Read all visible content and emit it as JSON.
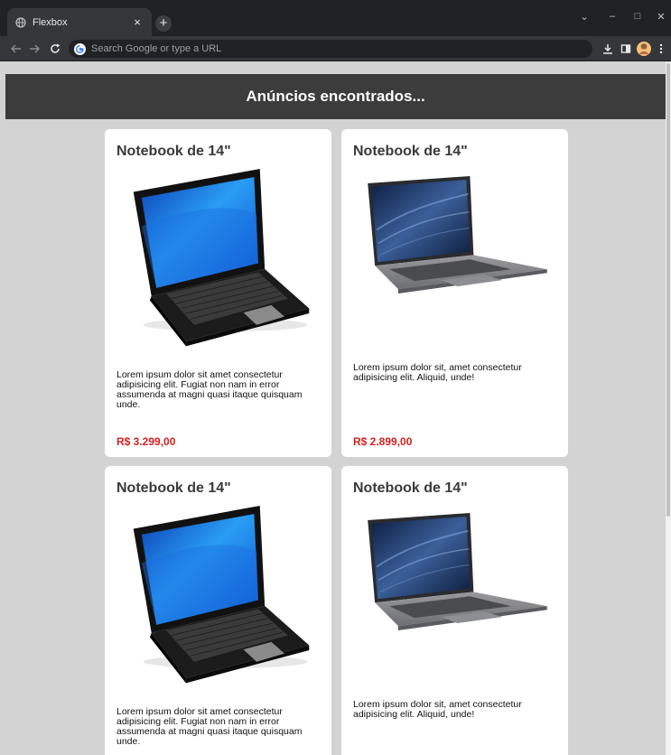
{
  "browser": {
    "tab_title": "Flexbox",
    "tab_close": "×",
    "new_tab": "+",
    "omnibox_placeholder": "Search Google or type a URL",
    "window_controls": {
      "dropdown": "⌄",
      "minimize": "–",
      "maximize": "□",
      "close": "✕"
    }
  },
  "page": {
    "header_title": "Anúncios encontrados...",
    "cards": [
      {
        "title": "Notebook de 14\"",
        "image": "black-laptop-illustration",
        "description": "Lorem ipsum dolor sit amet consectetur adipisicing elit. Fugiat non nam in error assumenda at magni quasi itaque quisquam unde.",
        "price": "R$ 3.299,00"
      },
      {
        "title": "Notebook de 14\"",
        "image": "silver-laptop-photo",
        "description": "Lorem ipsum dolor sit, amet consectetur adipisicing elit. Aliquid, unde!",
        "price": "R$ 2.899,00"
      },
      {
        "title": "Notebook de 14\"",
        "image": "black-laptop-illustration",
        "description": "Lorem ipsum dolor sit amet consectetur adipisicing elit. Fugiat non nam in error assumenda at magni quasi itaque quisquam unde."
      },
      {
        "title": "Notebook de 14\"",
        "image": "silver-laptop-photo",
        "description": "Lorem ipsum dolor sit, amet consectetur adipisicing elit. Aliquid, unde!"
      }
    ]
  },
  "colors": {
    "header_bg": "#3c3c3c",
    "page_bg": "#d3d3d3",
    "price": "#d62020",
    "chrome_bg": "#202124"
  }
}
